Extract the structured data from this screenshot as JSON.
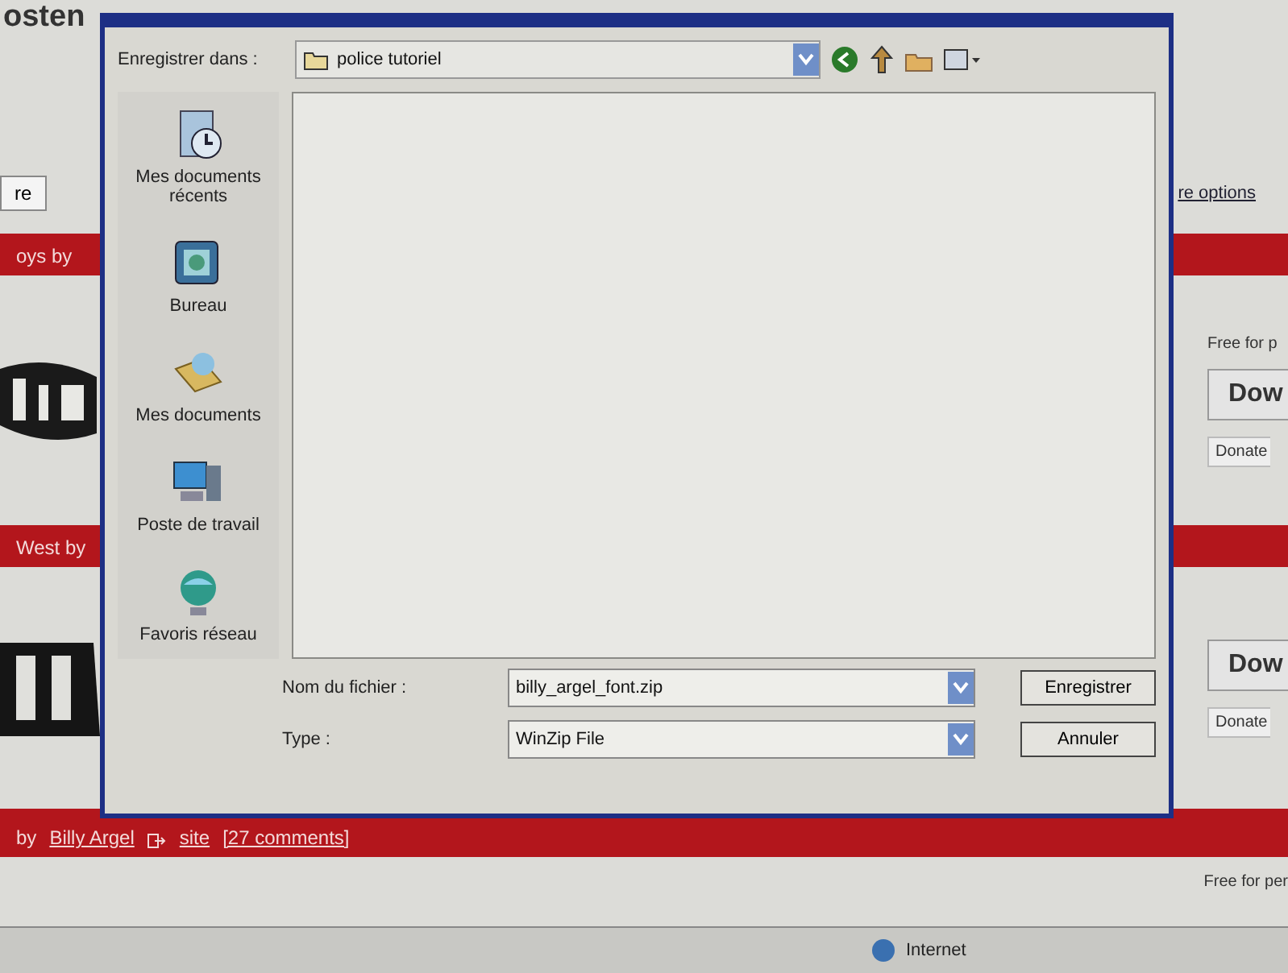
{
  "page": {
    "title": "osten",
    "button": "re",
    "link": "re options",
    "sections": [
      {
        "band": "oys by",
        "note": "Free for p",
        "download": "Dow",
        "donate": "Donate"
      },
      {
        "band": "West by",
        "download": "Dow",
        "donate": "Donate"
      }
    ],
    "footer_band": {
      "prefix": "by",
      "author": "Billy Argel",
      "site": "site",
      "comments": "[27 comments]"
    },
    "footer_note": "Free for per"
  },
  "dialog": {
    "save_in_label": "Enregistrer dans :",
    "folder": "police tutoriel",
    "places": [
      {
        "label": "Mes documents récents",
        "kind": "recent"
      },
      {
        "label": "Bureau",
        "kind": "desktop"
      },
      {
        "label": "Mes documents",
        "kind": "documents"
      },
      {
        "label": "Poste de travail",
        "kind": "computer"
      },
      {
        "label": "Favoris réseau",
        "kind": "network"
      }
    ],
    "file_name_label": "Nom du fichier :",
    "file_name": "billy_argel_font.zip",
    "type_label": "Type :",
    "type": "WinZip File",
    "buttons": [
      "Enregistrer",
      "Annuler"
    ]
  },
  "status_bar": {
    "zone": "Internet"
  }
}
